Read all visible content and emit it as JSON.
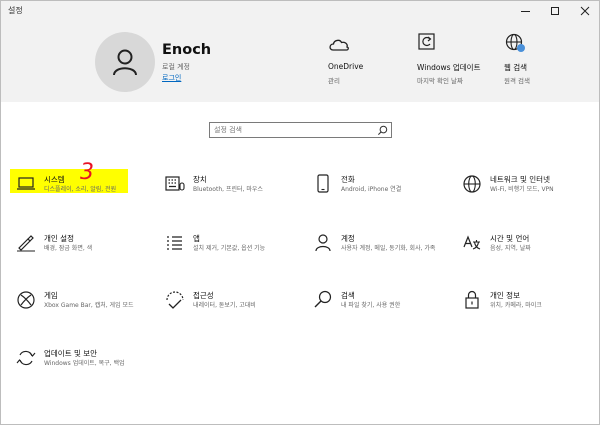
{
  "window": {
    "title": "설정"
  },
  "header": {
    "user": {
      "name": "Enoch",
      "account_type": "로컬 계정",
      "sign_in_link": "로그인"
    },
    "items": [
      {
        "title": "OneDrive",
        "sub": "관리"
      },
      {
        "title": "Windows 업데이트",
        "sub": "마지막 확인 날짜"
      },
      {
        "title": "웹 검색",
        "sub": "원격 검색"
      }
    ]
  },
  "search": {
    "placeholder": "설정 검색"
  },
  "grid": [
    {
      "title": "시스템",
      "desc": "디스플레이, 소리, 알림, 전원"
    },
    {
      "title": "장치",
      "desc": "Bluetooth, 프린터, 마우스"
    },
    {
      "title": "전화",
      "desc": "Android, iPhone 연결"
    },
    {
      "title": "네트워크 및 인터넷",
      "desc": "Wi-Fi, 비행기 모드, VPN"
    },
    {
      "title": "개인 설정",
      "desc": "배경, 잠금 화면, 색"
    },
    {
      "title": "앱",
      "desc": "설치 제거, 기본값, 옵션 기능"
    },
    {
      "title": "계정",
      "desc": "사용자 계정, 메일, 동기화, 회사, 가족"
    },
    {
      "title": "시간 및 언어",
      "desc": "음성, 지역, 날짜"
    },
    {
      "title": "게임",
      "desc": "Xbox Game Bar, 캡처, 게임 모드"
    },
    {
      "title": "접근성",
      "desc": "내레이터, 돋보기, 고대비"
    },
    {
      "title": "검색",
      "desc": "내 파일 찾기, 사용 권한"
    },
    {
      "title": "개인 정보",
      "desc": "위치, 카메라, 마이크"
    },
    {
      "title": "업데이트 및 보안",
      "desc": "Windows 업데이트, 복구, 백업"
    }
  ],
  "annotation": {
    "text": "3",
    "color": "#e81123"
  },
  "colors": {
    "accent": "#0067c0",
    "highlight": "#ffff00",
    "header_bg": "#f2f2f2"
  }
}
